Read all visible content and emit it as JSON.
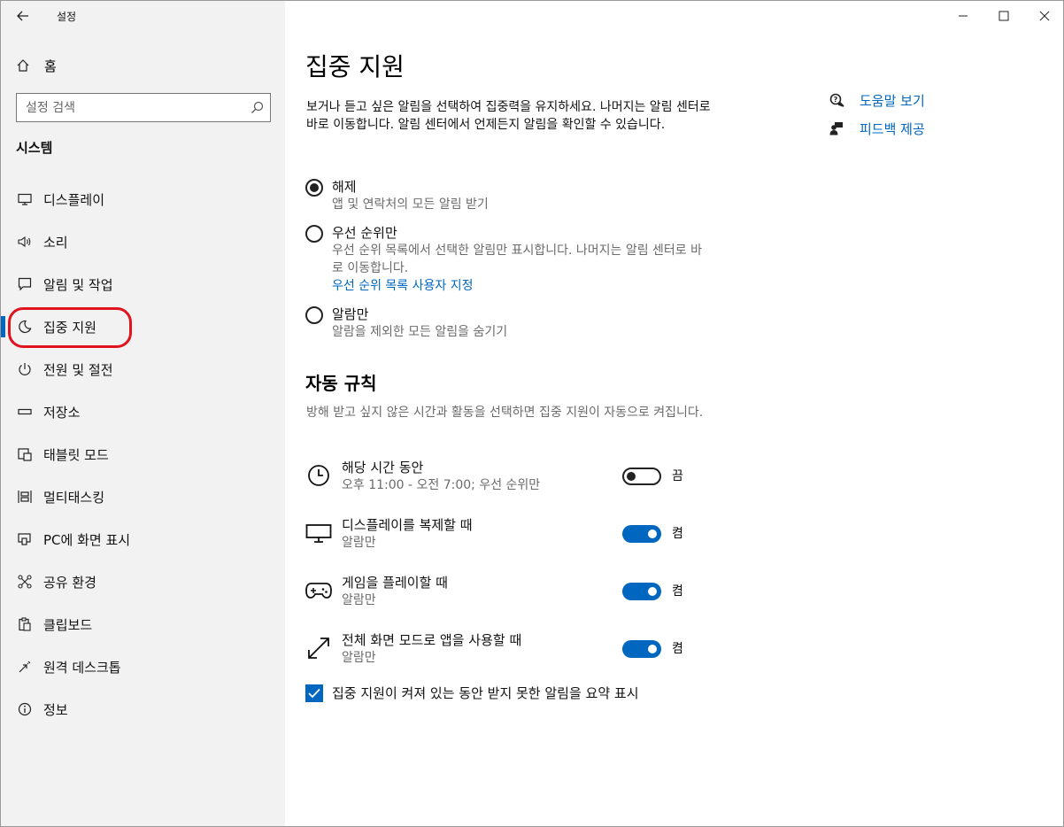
{
  "window": {
    "app_title": "설정"
  },
  "sidebar": {
    "home_label": "홈",
    "search_placeholder": "설정 검색",
    "section_label": "시스템",
    "items": [
      {
        "label": "디스플레이",
        "icon": "display-icon"
      },
      {
        "label": "소리",
        "icon": "speaker-icon"
      },
      {
        "label": "알림 및 작업",
        "icon": "notification-icon"
      },
      {
        "label": "집중 지원",
        "icon": "moon-icon",
        "selected": true
      },
      {
        "label": "전원 및 절전",
        "icon": "power-icon"
      },
      {
        "label": "저장소",
        "icon": "storage-icon"
      },
      {
        "label": "태블릿 모드",
        "icon": "tablet-icon"
      },
      {
        "label": "멀티태스킹",
        "icon": "multitasking-icon"
      },
      {
        "label": "PC에 화면 표시",
        "icon": "project-icon"
      },
      {
        "label": "공유 환경",
        "icon": "shared-experiences-icon"
      },
      {
        "label": "클립보드",
        "icon": "clipboard-icon"
      },
      {
        "label": "원격 데스크톱",
        "icon": "remote-desktop-icon"
      },
      {
        "label": "정보",
        "icon": "info-icon"
      }
    ]
  },
  "main": {
    "title": "집중 지원",
    "description": "보거나 듣고 싶은 알림을 선택하여 집중력을 유지하세요. 나머지는 알림 센터로 바로 이동합니다. 알림 센터에서 언제든지 알림을 확인할 수 있습니다.",
    "help_link": "도움말 보기",
    "feedback_link": "피드백 제공",
    "options": [
      {
        "label": "해제",
        "sub": "앱 및 연락처의 모든 알림 받기",
        "selected": true
      },
      {
        "label": "우선 순위만",
        "sub": "우선 순위 목록에서 선택한 알림만 표시합니다. 나머지는 알림 센터로 바로 이동합니다.",
        "link": "우선 순위 목록 사용자 지정",
        "selected": false
      },
      {
        "label": "알람만",
        "sub": "알람을 제외한 모든 알림을 숨기기",
        "selected": false
      }
    ],
    "auto_rules_title": "자동 규칙",
    "auto_rules_desc": "방해 받고 싶지 않은 시간과 활동을 선택하면 집중 지원이 자동으로 켜집니다.",
    "rules": [
      {
        "title": "해당 시간 동안",
        "sub": "오후 11:00 - 오전 7:00; 우선 순위만",
        "state": "끔",
        "on": false,
        "icon": "clock-icon"
      },
      {
        "title": "디스플레이를 복제할 때",
        "sub": "알람만",
        "state": "켬",
        "on": true,
        "icon": "monitor-icon"
      },
      {
        "title": "게임을 플레이할 때",
        "sub": "알람만",
        "state": "켬",
        "on": true,
        "icon": "gamepad-icon"
      },
      {
        "title": "전체 화면 모드로 앱을 사용할 때",
        "sub": "알람만",
        "state": "켬",
        "on": true,
        "icon": "fullscreen-icon"
      }
    ],
    "summary_checkbox_label": "집중 지원이 켜져 있는 동안 받지 못한 알림을 요약 표시",
    "summary_checked": true
  },
  "colors": {
    "accent": "#0067c0",
    "sidebar_bg": "#f2f2f2",
    "highlight": "#e0131e"
  }
}
